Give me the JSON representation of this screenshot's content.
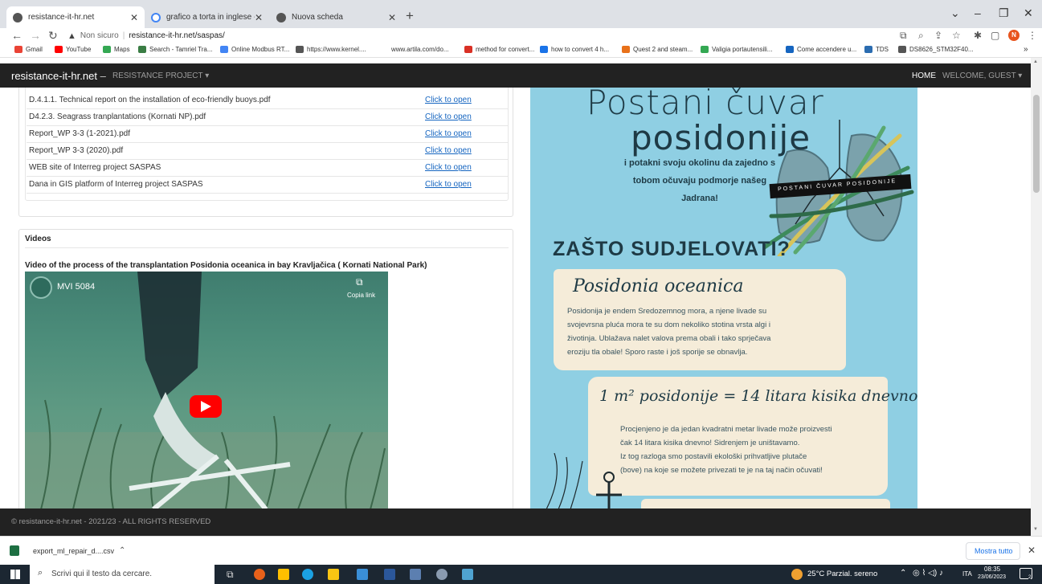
{
  "browser": {
    "tabs": [
      {
        "title": "resistance-it-hr.net",
        "active": true
      },
      {
        "title": "grafico a torta in inglese - Cerca",
        "active": false
      },
      {
        "title": "Nuova scheda",
        "active": false
      }
    ],
    "new_tab": "+",
    "address": {
      "security": "Non sicuro",
      "url": "resistance-it-hr.net/saspas/"
    },
    "profile_initial": "N",
    "bookmarks": [
      {
        "label": "Gmail",
        "color": "#ea4335"
      },
      {
        "label": "YouTube",
        "color": "#ff0000"
      },
      {
        "label": "Maps",
        "color": "#34a853"
      },
      {
        "label": "Search - Tamriel Tra...",
        "color": "#3a7d44"
      },
      {
        "label": "Online Modbus RT...",
        "color": "#4285f4"
      },
      {
        "label": "https://www.kernel....",
        "color": "#555555"
      },
      {
        "label": "www.artila.com/do...",
        "color": "#ffffff"
      },
      {
        "label": "method for convert...",
        "color": "#d93025"
      },
      {
        "label": "how to convert 4 h...",
        "color": "#1a73e8"
      },
      {
        "label": "Quest 2 and steam...",
        "color": "#e8711a"
      },
      {
        "label": "Valigia portautensili...",
        "color": "#34a853"
      },
      {
        "label": "Come accendere u...",
        "color": "#1565c0"
      },
      {
        "label": "TDS",
        "color": "#2b6cb0"
      },
      {
        "label": "DS8626_STM32F40...",
        "color": "#555555"
      }
    ],
    "bookmarks_more": "»"
  },
  "site": {
    "brand": "resistance-it-hr.net",
    "brand_sep": "–",
    "project_menu": "RESISTANCE PROJECT ▾",
    "home": "HOME",
    "welcome": "WELCOME, GUEST ▾"
  },
  "documents": {
    "rows": [
      {
        "name": "D.4.1.1. Technical report on the installation of eco-friendly buoys.pdf",
        "link": "Click to open"
      },
      {
        "name": "D4.2.3. Seagrass tranplantations (Kornati NP).pdf",
        "link": "Click to open"
      },
      {
        "name": "Report_WP 3-3 (1-2021).pdf",
        "link": "Click to open"
      },
      {
        "name": "Report_WP 3-3 (2020).pdf",
        "link": "Click to open"
      },
      {
        "name": "WEB site of Interreg project SASPAS",
        "link": "Click to open"
      },
      {
        "name": "Dana in GIS platform of Interreg project SASPAS",
        "link": "Click to open"
      }
    ]
  },
  "videos": {
    "heading": "Videos",
    "title": "Video of the process of the transplantation Posidonia oceanica in bay Kravljačica ( Kornati National Park)",
    "video_name": "MVI 5084",
    "copy_link": "Copia link"
  },
  "poster": {
    "title_line1": "Postani čuvar",
    "title_line2": "posidonije",
    "intro": [
      "i potakni svoju okolinu da zajedno s",
      "tobom očuvaju podmorje našeg",
      "Jadrana!"
    ],
    "ribbon": "POSTANI ČUVAR POSIDONIJE",
    "why": "ZAŠTO SUDJELOVATI?",
    "card1_title": "Posidonia oceanica",
    "card1_lines": [
      "Posidonija je endem Sredozemnog mora, a njene livade su",
      "svojevrsna pluća mora te su dom nekoliko stotina vrsta algi i",
      "životinja. Ublažava nalet valova prema obali i tako sprječava",
      "eroziju tla obale! Sporo raste i još sporije se obnavlja."
    ],
    "card2_title": "1 m² posidonije = 14 litara kisika dnevno",
    "card2_lines": [
      "Procjenjeno je da jedan kvadratni metar livade može proizvesti",
      "čak 14 litara kisika dnevno! Sidrenjem je uništavamo.",
      "Iz tog razloga smo postavili ekološki prihvatljive plutače",
      "(bove) na koje se možete privezati te je na taj način očuvati!"
    ]
  },
  "footer": "© resistance-it-hr.net - 2021/23 - ALL RIGHTS RESERVED",
  "download": {
    "file": "export_ml_repair_d....csv",
    "show_all": "Mostra tutto"
  },
  "taskbar": {
    "search_placeholder": "Scrivi qui il testo da cercare.",
    "weather": "25°C  Parzial. sereno",
    "lang": "ITA",
    "time": "08:35",
    "date": "23/06/2023",
    "notif_count": "2"
  }
}
